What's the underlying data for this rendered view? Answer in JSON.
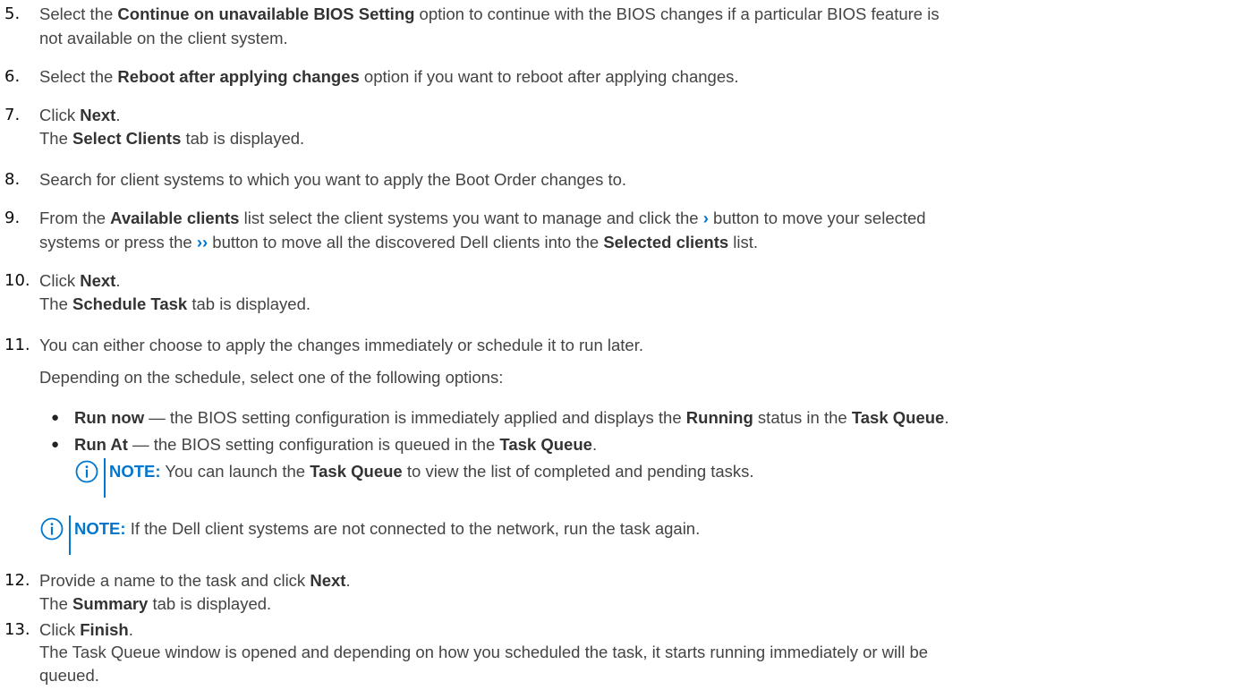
{
  "colors": {
    "accent": "#0076ce",
    "text": "#444444",
    "number": "#0b0b0b"
  },
  "steps": {
    "s5": {
      "num": "5.",
      "l1a": "Select the ",
      "l1b": "Continue on unavailable BIOS Setting",
      "l1c": " option to continue with the BIOS changes if a particular BIOS feature is",
      "l2": "not available on the client system."
    },
    "s6": {
      "num": "6.",
      "a": "Select the ",
      "b": "Reboot after applying changes",
      "c": " option if you want to reboot after applying changes."
    },
    "s7": {
      "num": "7.",
      "l1a": "Click ",
      "l1b": "Next",
      "l1c": ".",
      "l2a": "The ",
      "l2b": "Select Clients",
      "l2c": " tab is displayed."
    },
    "s8": {
      "num": "8.",
      "text": "Search for client systems to which you want to apply the Boot Order changes to."
    },
    "s9": {
      "num": "9.",
      "l1a": "From the ",
      "l1b": "Available clients",
      "l1c": " list select the client systems you want to manage and click the ",
      "l1icon": "›",
      "l1d": " button to move your selected",
      "l2a": "systems or press the ",
      "l2icon": "››",
      "l2b": " button to move all the discovered Dell clients into the ",
      "l2c": "Selected clients",
      "l2d": " list."
    },
    "s10": {
      "num": "10.",
      "l1a": "Click ",
      "l1b": "Next",
      "l1c": ".",
      "l2a": "The ",
      "l2b": "Schedule Task",
      "l2c": " tab is displayed."
    },
    "s11": {
      "num": "11.",
      "l1": "You can either choose to apply the changes immediately or schedule it to run later.",
      "l2": "Depending on the schedule, select one of the following options:",
      "bullet_glyph": "●",
      "b1a": "Run now",
      "b1b": " — the BIOS setting configuration is immediately applied and displays the ",
      "b1c": "Running",
      "b1d": " status in the ",
      "b1e": "Task Queue",
      "b1f": ".",
      "b2a": "Run At",
      "b2b": " — the BIOS setting configuration is queued in the ",
      "b2c": "Task Queue",
      "b2d": ".",
      "note1_label": "NOTE:",
      "note1a": " You can launch the ",
      "note1b": "Task Queue",
      "note1c": " to view the list of completed and pending tasks."
    },
    "note2": {
      "label": "NOTE:",
      "text": " If the Dell client systems are not connected to the network, run the task again."
    },
    "s12": {
      "num": "12.",
      "l1a": "Provide a name to the task and click ",
      "l1b": "Next",
      "l1c": ".",
      "l2a": "The ",
      "l2b": "Summary",
      "l2c": " tab is displayed."
    },
    "s13": {
      "num": "13.",
      "l1a": "Click ",
      "l1b": "Finish",
      "l1c": ".",
      "l2": "The Task Queue window is opened and depending on how you scheduled the task, it starts running immediately or will be",
      "l3": "queued."
    }
  }
}
